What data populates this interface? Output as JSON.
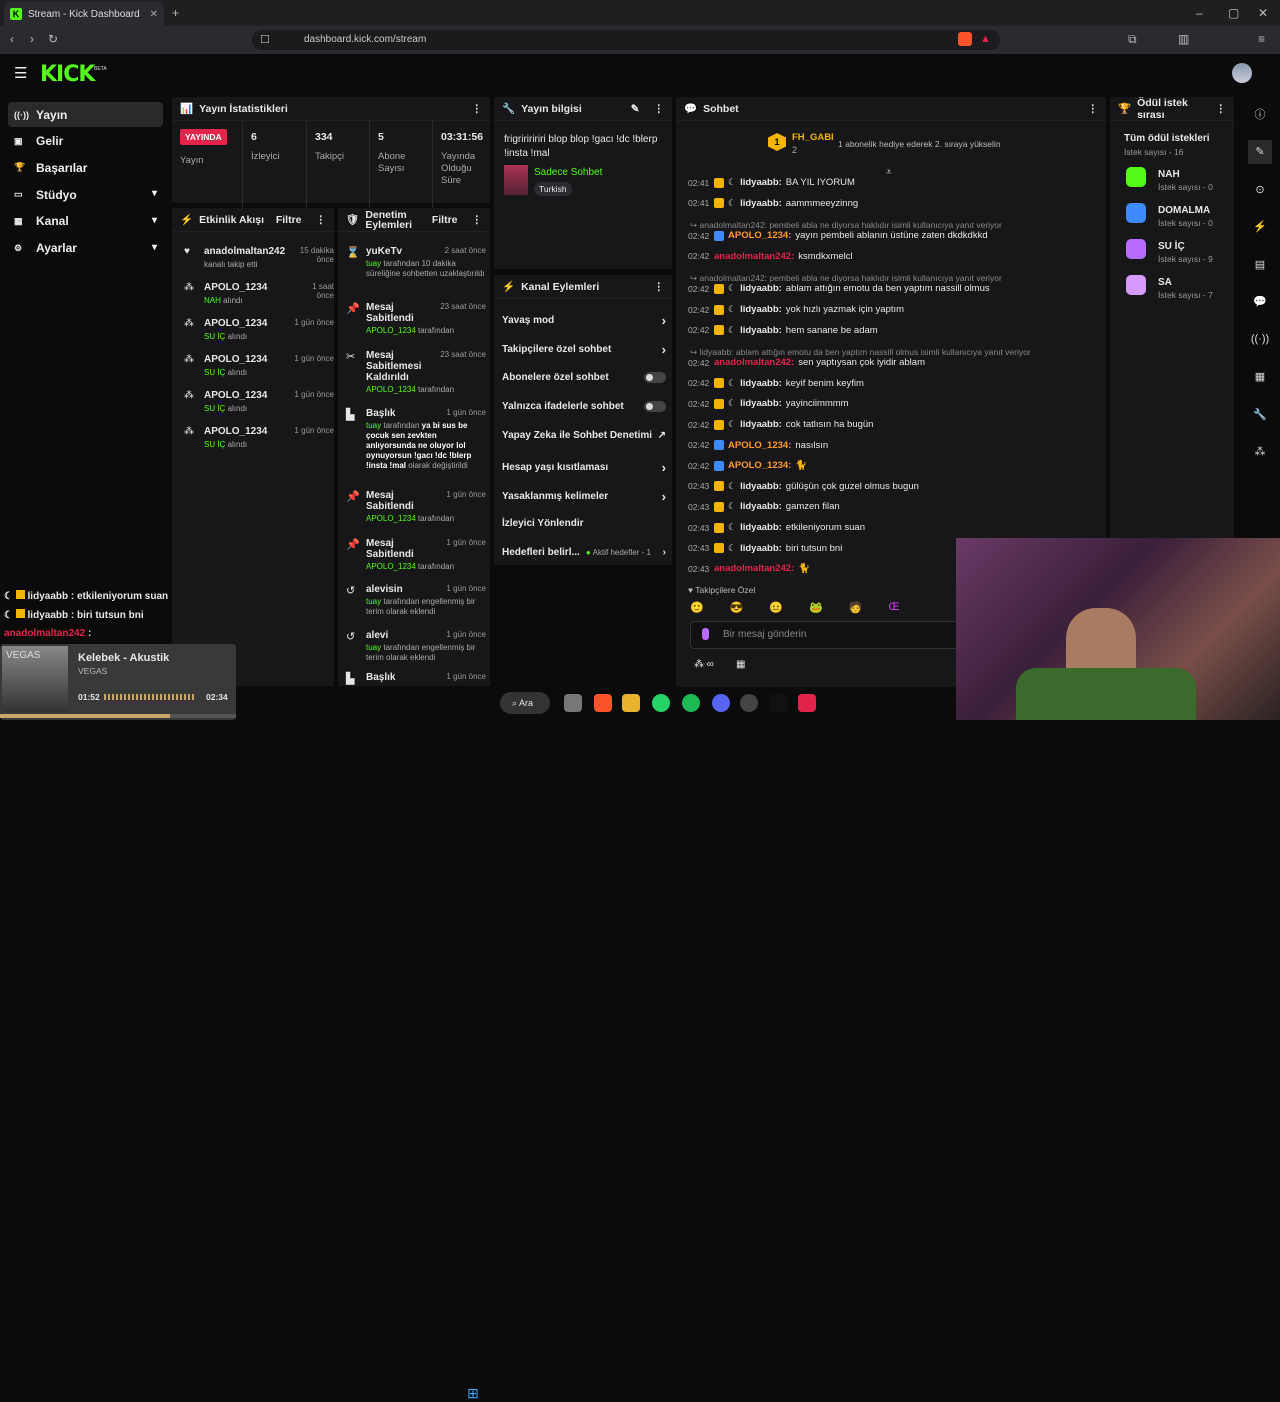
{
  "browser": {
    "tab_title": "Stream - Kick Dashboard",
    "url": "dashboard.kick.com/stream"
  },
  "logo": "KICK",
  "logo_beta": "BETA",
  "sidebar": [
    {
      "label": "Yayın",
      "icon": "broadcast-icon"
    },
    {
      "label": "Gelir",
      "icon": "money-icon"
    },
    {
      "label": "Başarılar",
      "icon": "trophy-icon"
    },
    {
      "label": "Stüdyo",
      "icon": "studio-icon"
    },
    {
      "label": "Kanal",
      "icon": "channel-icon"
    },
    {
      "label": "Ayarlar",
      "icon": "gear-icon"
    }
  ],
  "stats": {
    "title": "Yayın İstatistikleri",
    "live_badge": "YAYINDA",
    "live_label": "Yayın",
    "items": [
      {
        "v": "6",
        "l": "İzleyici"
      },
      {
        "v": "334",
        "l": "Takipçi"
      },
      {
        "v": "5",
        "l": "Abone Sayısı"
      },
      {
        "v": "03:31:56",
        "l": "Yayında Olduğu Süre"
      }
    ]
  },
  "activity": {
    "title": "Etkinlik Akışı",
    "filter": "Filtre",
    "items": [
      {
        "n": "anadolmaltan242",
        "t": "15 dakika önce",
        "s": "kanalı takip etti"
      },
      {
        "n": "APOLO_1234",
        "t": "1 saat önce",
        "s1": "NAH",
        "s2": "alındı"
      },
      {
        "n": "APOLO_1234",
        "t": "1 gün önce",
        "s1": "SU İÇ",
        "s2": "alındı"
      },
      {
        "n": "APOLO_1234",
        "t": "1 gün önce",
        "s1": "SU İÇ",
        "s2": "alındı"
      },
      {
        "n": "APOLO_1234",
        "t": "1 gün önce",
        "s1": "SU İÇ",
        "s2": "alındı"
      },
      {
        "n": "APOLO_1234",
        "t": "1 gün önce",
        "s1": "SU İÇ",
        "s2": "alındı"
      }
    ]
  },
  "mod": {
    "title": "Denetim Eylemleri",
    "filter": "Filtre",
    "items": [
      {
        "n": "yuKeTv",
        "t": "2 saat önce",
        "s1": "tuay",
        "s2": "tarafından 10 dakika süreliğine sohbetten uzaklaştırıldı"
      },
      {
        "n": "Mesaj Sabitlendi",
        "t": "23 saat önce",
        "s1": "APOLO_1234",
        "s2": "tarafından"
      },
      {
        "n": "Mesaj Sabitlemesi Kaldırıldı",
        "t": "23 saat önce",
        "s1": "APOLO_1234",
        "s2": "tarafından"
      },
      {
        "n": "Başlık",
        "t": "1 gün önce",
        "s1": "tuay",
        "s2": "tarafından",
        "s3": "ya bi sus be çocuk sen zevkten anlıyorsunda ne oluyor lol oynuyorsun !gacı !dc !blerp !insta !mal",
        "s4": "olarak değiştirildi"
      },
      {
        "n": "Mesaj Sabitlendi",
        "t": "1 gün önce",
        "s1": "APOLO_1234",
        "s2": "tarafından"
      },
      {
        "n": "Mesaj Sabitlendi",
        "t": "1 gün önce",
        "s1": "APOLO_1234",
        "s2": "tarafından"
      },
      {
        "n": "alevisin",
        "t": "1 gün önce",
        "s1": "tuay",
        "s2": "tarafından engellenmiş bir terim olarak eklendi"
      },
      {
        "n": "alevi",
        "t": "1 gün önce",
        "s1": "tuay",
        "s2": "tarafından engellenmiş bir terim olarak eklendi"
      },
      {
        "n": "Başlık",
        "t": "1 gün önce"
      }
    ]
  },
  "info": {
    "title": "Yayın bilgisi",
    "stream_title": "frigririririri blop blop !gacı !dc !blerp !insta !mal",
    "category": "Sadece Sohbet",
    "tag": "Turkish"
  },
  "channel": {
    "title": "Kanal Eylemleri",
    "items": [
      "Yavaş mod",
      "Takipçilere özel sohbet",
      "Abonelere özel sohbet",
      "Yalnızca ifadelerle sohbet",
      "Yapay Zeka ile Sohbet Denetimi",
      "Hesap yaşı kısıtlaması",
      "Yasaklanmış kelimeler",
      "İzleyici Yönlendir",
      "Hedefleri belirl..."
    ],
    "goals_status": "Aktif hedefler - 1"
  },
  "chat": {
    "title": "Sohbet",
    "pin_user": "FH_GABI",
    "pin_count": "2",
    "pin_msg": "1 abonelik hediye ederek 2. sıraya yükselin",
    "follower_only": "Takipçilere Özel",
    "input_placeholder": "Bir mesaj gönderin",
    "messages": [
      {
        "tm": "02:41",
        "u": "lidyaabb",
        "txt": "BA YIL IYORUM"
      },
      {
        "tm": "02:41",
        "u": "lidyaabb",
        "txt": "aammmeeyzinng"
      },
      {
        "reply": "anadolmaltan242: pembeli abla ne diyorsa haklıdır isimli kullanıcıya yanıt veriyor"
      },
      {
        "tm": "02:42",
        "u": "APOLO_1234",
        "txt": "yayın pembeli ablanın üstüne zaten dkdkdkkd"
      },
      {
        "tm": "02:42",
        "u": "anadolmaltan242",
        "txt": "ksmdkxmelcl"
      },
      {
        "reply": "anadolmaltan242: pembeli abla ne diyorsa haklıdır isimli kullanıcıya yanıt veriyor"
      },
      {
        "tm": "02:42",
        "u": "lidyaabb",
        "txt": "ablam attığın emotu da ben yaptım nassill olmus"
      },
      {
        "tm": "02:42",
        "u": "lidyaabb",
        "txt": "yok hızlı yazmak için yaptım"
      },
      {
        "tm": "02:42",
        "u": "lidyaabb",
        "txt": "hem sanane be adam"
      },
      {
        "reply": "lidyaabb: ablam attığın emotu da ben yaptım nassill olmus isimli kullanıcıya yanıt veriyor"
      },
      {
        "tm": "02:42",
        "u": "anadolmaltan242",
        "txt": "sen yaptıysan çok iyidir ablam"
      },
      {
        "tm": "02:42",
        "u": "lidyaabb",
        "txt": "keyif benim keyfim"
      },
      {
        "tm": "02:42",
        "u": "lidyaabb",
        "txt": "yayinciimmmm"
      },
      {
        "tm": "02:42",
        "u": "lidyaabb",
        "txt": "cok tatlısın ha bugün"
      },
      {
        "tm": "02:42",
        "u": "APOLO_1234",
        "txt": "nasılsın"
      },
      {
        "tm": "02:42",
        "u": "APOLO_1234",
        "txt": ""
      },
      {
        "tm": "02:43",
        "u": "lidyaabb",
        "txt": "gülüşün çok guzel olmus bugun"
      },
      {
        "tm": "02:43",
        "u": "lidyaabb",
        "txt": "gamzen filan"
      },
      {
        "tm": "02:43",
        "u": "lidyaabb",
        "txt": "etkileniyorum suan"
      },
      {
        "tm": "02:43",
        "u": "lidyaabb",
        "txt": "biri tutsun bni"
      },
      {
        "tm": "02:43",
        "u": "anadolmaltan242",
        "txt": ""
      }
    ]
  },
  "rewards": {
    "title": "Ödül istek sırası",
    "all": "Tüm ödül istekleri",
    "all_count": "İstek sayısı - 16",
    "items": [
      {
        "n": "NAH",
        "c": "İstek sayısı - 0",
        "color": "#53fc18"
      },
      {
        "n": "DOMALMA",
        "c": "İstek sayısı - 0",
        "color": "#3d8bff"
      },
      {
        "n": "SU İÇ",
        "c": "İstek sayısı - 9",
        "color": "#b86bff"
      },
      {
        "n": "SA",
        "c": "İstek sayısı - 7",
        "color": "#d79bff"
      }
    ]
  },
  "overlay": {
    "lines": [
      {
        "u": "lidyaabb",
        "txt": ": etkileniyorum suan"
      },
      {
        "u": "lidyaabb",
        "txt": ": biri tutsun bni"
      },
      {
        "u": "anadolmaltan242",
        "txt": ":"
      }
    ],
    "song": "Kelebek - Akustik",
    "artist": "VEGAS",
    "album_text": "VEGAS",
    "t1": "01:52",
    "t2": "02:34",
    "progress": 0.72
  },
  "taskbar": {
    "search": "Ara"
  },
  "colors": {
    "kick_green": "#53fc18",
    "live_red": "#e3244a",
    "apolo_orange": "#ff9a2e",
    "anadol_red": "#e3244a"
  }
}
